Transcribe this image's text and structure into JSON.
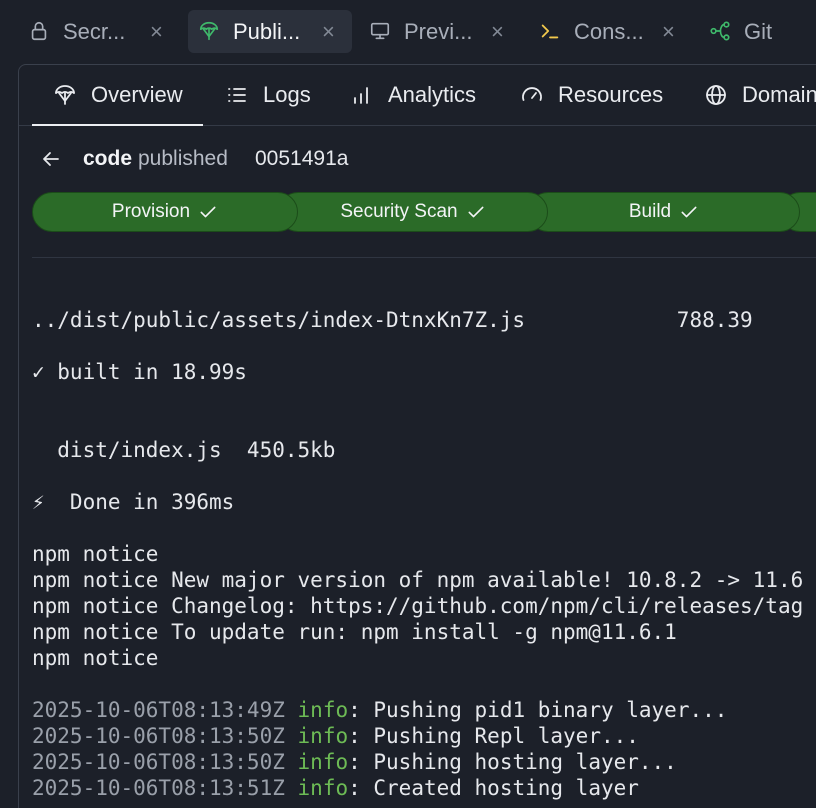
{
  "colors": {
    "background": "#1c2029",
    "active_tab": "#2b303b",
    "step_green": "#2b6b28",
    "info_green": "#6dbb55",
    "timestamp_gray": "#9aa0aa",
    "console_yellow": "#f2c94c",
    "git_green": "#3fb96b"
  },
  "tabs": [
    {
      "label": "Secr...",
      "icon": "lock-icon",
      "active": false,
      "closable": true
    },
    {
      "label": "Publi...",
      "icon": "deploy-icon",
      "active": true,
      "closable": true
    },
    {
      "label": "Previ...",
      "icon": "monitor-icon",
      "active": false,
      "closable": true
    },
    {
      "label": "Cons...",
      "icon": "console-icon",
      "active": false,
      "closable": true
    },
    {
      "label": "Git",
      "icon": "git-icon",
      "active": false,
      "closable": false
    }
  ],
  "close_glyph": "×",
  "subnav": [
    {
      "label": "Overview",
      "icon": "deploy-icon",
      "active": true
    },
    {
      "label": "Logs",
      "icon": "list-icon",
      "active": false
    },
    {
      "label": "Analytics",
      "icon": "bar-chart-icon",
      "active": false
    },
    {
      "label": "Resources",
      "icon": "gauge-icon",
      "active": false
    },
    {
      "label": "Domain",
      "icon": "globe-icon",
      "active": false
    }
  ],
  "header": {
    "app_name": "code",
    "status": "published",
    "commit": "0051491a"
  },
  "steps": [
    {
      "label": "Provision",
      "status": "done"
    },
    {
      "label": "Security Scan",
      "status": "done"
    },
    {
      "label": "Build",
      "status": "done"
    }
  ],
  "log": {
    "lines": [
      {
        "text": "../dist/public/assets/index-DtnxKn7Z.js            788.39"
      },
      {
        "text": ""
      },
      {
        "text": "✓ built in 18.99s"
      },
      {
        "text": ""
      },
      {
        "text": ""
      },
      {
        "text": "  dist/index.js  450.5kb"
      },
      {
        "text": ""
      },
      {
        "text": "⚡  Done in 396ms"
      },
      {
        "text": ""
      },
      {
        "text": "npm notice"
      },
      {
        "text": "npm notice New major version of npm available! 10.8.2 -> 11.6"
      },
      {
        "text": "npm notice Changelog: https://github.com/npm/cli/releases/tag"
      },
      {
        "text": "npm notice To update run: npm install -g npm@11.6.1"
      },
      {
        "text": "npm notice"
      },
      {
        "text": ""
      },
      {
        "ts": "2025-10-06T08:13:49Z",
        "level": "info",
        "msg": ": Pushing pid1 binary layer..."
      },
      {
        "ts": "2025-10-06T08:13:50Z",
        "level": "info",
        "msg": ": Pushing Repl layer..."
      },
      {
        "ts": "2025-10-06T08:13:50Z",
        "level": "info",
        "msg": ": Pushing hosting layer..."
      },
      {
        "ts": "2025-10-06T08:13:51Z",
        "level": "info",
        "msg": ": Created hosting layer"
      }
    ]
  }
}
